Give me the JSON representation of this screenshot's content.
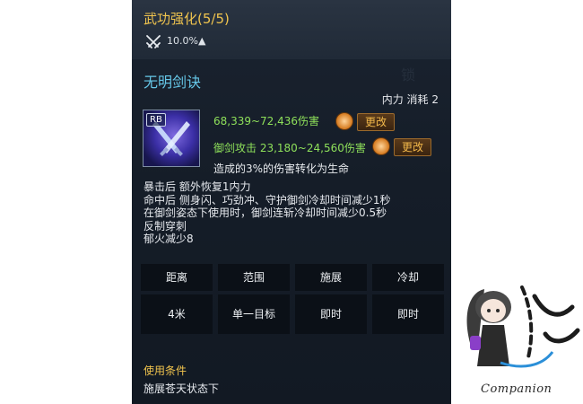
{
  "tooltip": {
    "header": {
      "title": "武功强化(5/5)",
      "stat_icon": "crossed-swords-icon",
      "stat_value": "10.0%▲"
    },
    "skill": {
      "name": "无明剑诀",
      "cost": "内力 消耗 2",
      "icon": "twin-blades-skill-icon",
      "key": "RB",
      "damage_main": "68,339~72,436伤害",
      "damage_sub": "御剑攻击 23,180~24,560伤害",
      "change_label": "更改",
      "hand_icon": "orange-fist-icon",
      "conversion": "造成的3%的伤害转化为生命"
    },
    "effects": [
      "暴击后 额外恢复1内力",
      "命中后 侧身闪、巧劲冲、守护御剑冷却时间减少1秒",
      "在御剑姿态下使用时，御剑连斩冷却时间减少0.5秒",
      "反制穿刺",
      "郁火减少8"
    ],
    "stats_table": {
      "headers": [
        "距离",
        "范围",
        "施展",
        "冷却"
      ],
      "values": [
        "4米",
        "单一目标",
        "即时",
        "即时"
      ]
    },
    "condition": {
      "label": "使用条件",
      "text": "施展苍天状态下"
    },
    "colors": {
      "title": "#f0c44e",
      "skill_name": "#66c7e8",
      "damage": "#8ee05a",
      "button_text": "#f2b84a"
    }
  },
  "watermark": {
    "caption": "Companion"
  }
}
